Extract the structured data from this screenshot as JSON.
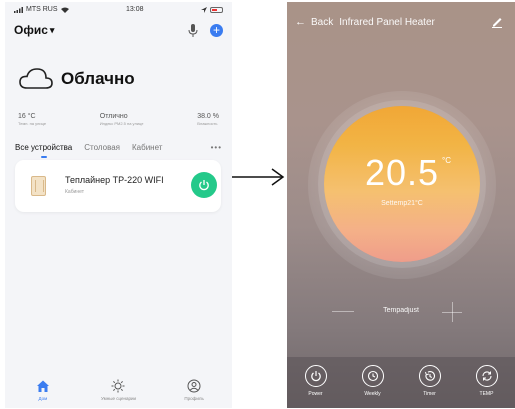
{
  "left_phone": {
    "status_bar": {
      "carrier": "MTS RUS",
      "time": "13:08"
    },
    "header": {
      "home_name": "Офис",
      "dropdown_arrow": "▾"
    },
    "weather": {
      "condition": "Облачно",
      "icon": "cloud-icon"
    },
    "stats": [
      {
        "value": "16 °C",
        "label": "Темп. на улице"
      },
      {
        "value": "Отлично",
        "label": "Индекс PM2.5 на улице"
      },
      {
        "value": "38.0 %",
        "label": "Влажность"
      }
    ],
    "tabs": [
      "Все устройства",
      "Столовая",
      "Кабинет"
    ],
    "tab_more": "•••",
    "device": {
      "name": "Теплайнер TP-220 WIFI",
      "room": "Кабинет"
    },
    "nav": [
      {
        "label": "Дом",
        "icon": "home-icon",
        "active": true
      },
      {
        "label": "Умные сценарии",
        "icon": "sun-icon",
        "active": false
      },
      {
        "label": "Профиль",
        "icon": "profile-icon",
        "active": false
      }
    ]
  },
  "right_phone": {
    "back_label": "Back",
    "title": "Infrared Panel Heater",
    "temperature": "20.5",
    "unit": "°C",
    "settemp": "Settemp21°C",
    "adjust_label": "Tempadjust",
    "controls": [
      {
        "label": "Power",
        "icon": "power-icon"
      },
      {
        "label": "Weekly",
        "icon": "clock-icon"
      },
      {
        "label": "Timer",
        "icon": "timer-icon"
      },
      {
        "label": "TEMP",
        "icon": "refresh-icon"
      }
    ]
  },
  "colors": {
    "accent_blue": "#3a7cf0",
    "power_green": "#24c98a",
    "dial_orange": "#f1a736"
  }
}
